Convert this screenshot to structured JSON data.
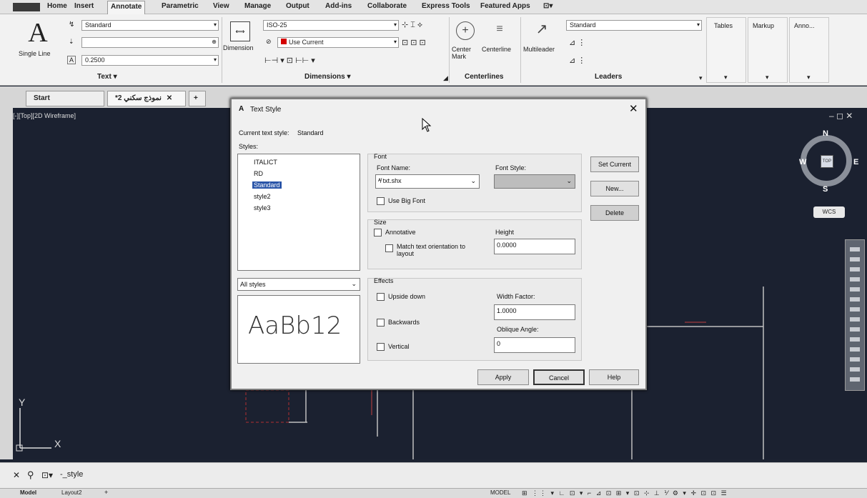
{
  "ribbon_tabs": [
    "Home",
    "Insert",
    "Annotate",
    "Parametric",
    "View",
    "Manage",
    "Output",
    "Add-ins",
    "Collaborate",
    "Express Tools",
    "Featured Apps"
  ],
  "ribbon_tab_active": "Annotate",
  "text_panel": {
    "big_label": "Single Line",
    "style_value": "Standard",
    "find_value": "",
    "height_value": "0.2500",
    "title": "Text"
  },
  "dimensions_panel": {
    "big_label": "Dimension",
    "dimstyle_value": "ISO-25",
    "layer_value": "Use Current",
    "title": "Dimensions"
  },
  "centerlines_panel": {
    "center_mark": "Center Mark",
    "centerline": "Centerline",
    "title": "Centerlines"
  },
  "leaders_panel": {
    "big_label": "Multileader",
    "style_value": "Standard",
    "title": "Leaders"
  },
  "extra_panels": [
    "Tables",
    "Markup",
    "Anno..."
  ],
  "doc_tabs": [
    {
      "label": "Start"
    },
    {
      "label": "*نموذج سكني 2"
    }
  ],
  "viewport_label": "[-][Top][2D Wireframe]",
  "viewcube": {
    "n": "N",
    "s": "S",
    "e": "E",
    "w": "W",
    "top": "TOP",
    "wcs": "WCS"
  },
  "ucs": {
    "x": "X",
    "y": "Y"
  },
  "command_line": "-_style",
  "layout_tabs": [
    "Model",
    "Layout2"
  ],
  "status_model": "MODEL",
  "dialog": {
    "title": "Text Style",
    "current_style_label": "Current text style:",
    "current_style_value": "Standard",
    "styles_label": "Styles:",
    "styles": [
      "ITALICT",
      "RD",
      "Standard",
      "style2",
      "style3"
    ],
    "selected_style": "Standard",
    "filter_value": "All styles",
    "preview_text": "AaBb12",
    "font_group": "Font",
    "font_name_label": "Font Name:",
    "font_name_value": "txt.shx",
    "font_style_label": "Font Style:",
    "font_style_value": "",
    "use_big_font": "Use Big Font",
    "size_group": "Size",
    "annotative": "Annotative",
    "match_orientation": "Match text orientation to layout",
    "height_label": "Height",
    "height_value": "0.0000",
    "effects_group": "Effects",
    "upside_down": "Upside down",
    "backwards": "Backwards",
    "vertical": "Vertical",
    "width_factor_label": "Width Factor:",
    "width_factor_value": "1.0000",
    "oblique_label": "Oblique Angle:",
    "oblique_value": "0",
    "set_current": "Set Current",
    "new": "New...",
    "delete": "Delete",
    "apply": "Apply",
    "cancel": "Cancel",
    "help": "Help"
  }
}
